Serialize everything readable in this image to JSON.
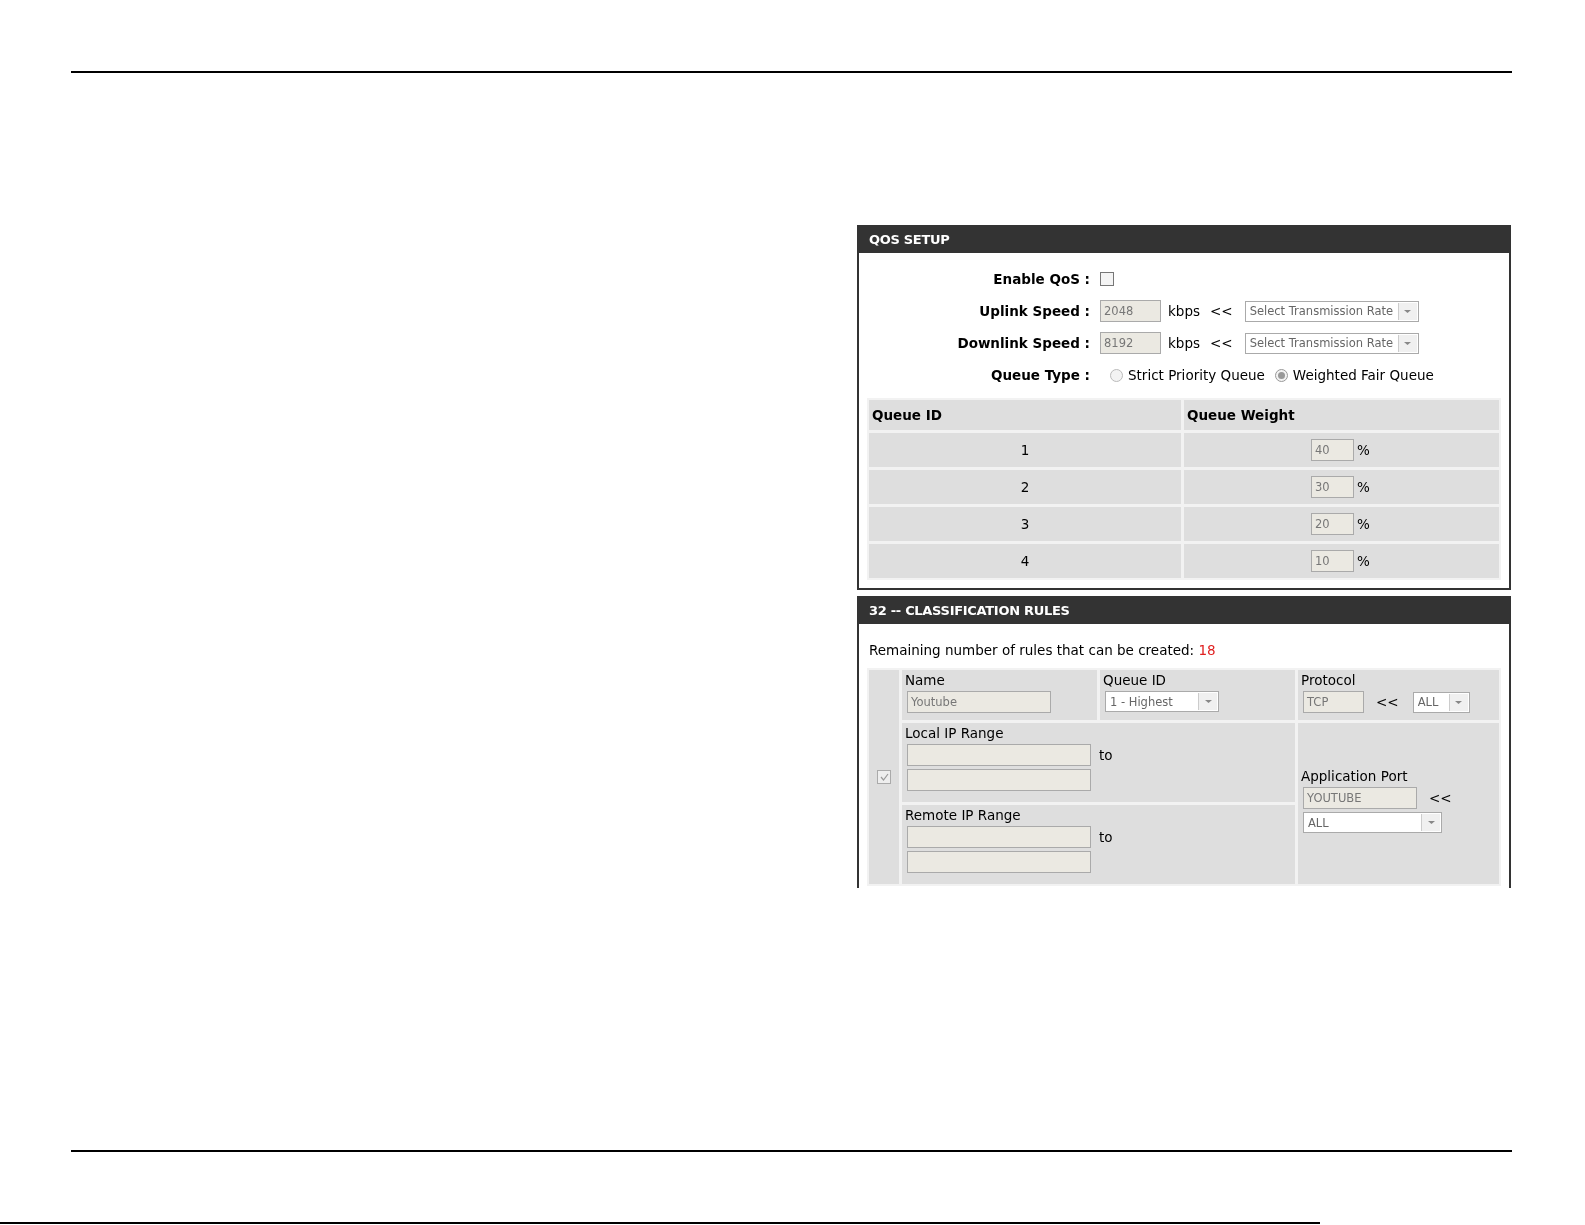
{
  "qos_setup": {
    "title": "QOS SETUP",
    "enable_qos": {
      "label": "Enable QoS :",
      "checked": false
    },
    "speeds": [
      {
        "label": "Uplink Speed :",
        "value": "2048",
        "unit": "kbps",
        "arrow": "<<",
        "select": "Select Transmission Rate"
      },
      {
        "label": "Downlink Speed :",
        "value": "8192",
        "unit": "kbps",
        "arrow": "<<",
        "select": "Select Transmission Rate"
      }
    ],
    "queue_type": {
      "label": "Queue Type :",
      "options": [
        {
          "label": "Strict Priority Queue",
          "selected": false
        },
        {
          "label": "Weighted Fair Queue",
          "selected": true
        }
      ]
    },
    "queue_table": {
      "columns": [
        "Queue ID",
        "Queue Weight"
      ],
      "rows": [
        {
          "queue_id": "1",
          "weight": "40",
          "unit": "%"
        },
        {
          "queue_id": "2",
          "weight": "30",
          "unit": "%"
        },
        {
          "queue_id": "3",
          "weight": "20",
          "unit": "%"
        },
        {
          "queue_id": "4",
          "weight": "10",
          "unit": "%"
        }
      ]
    }
  },
  "classification_rules": {
    "title": "32 -- CLASSIFICATION RULES",
    "remaining": {
      "label": "Remaining number of rules that can be created:",
      "count": "18"
    },
    "rule": {
      "checked": true,
      "name_label": "Name",
      "name": "Youtube",
      "queue_id_label": "Queue ID",
      "queue_id": "1 - Highest",
      "protocol_label": "Protocol",
      "protocol": "TCP",
      "protocol_arrow": "<<",
      "protocol_select": "ALL",
      "local_ip_label": "Local IP Range",
      "local_to": "to",
      "remote_ip_label": "Remote IP Range",
      "remote_to": "to",
      "app_port_label": "Application Port",
      "app_port": "YOUTUBE",
      "app_port_arrow": "<<",
      "app_port_select": "ALL"
    }
  }
}
